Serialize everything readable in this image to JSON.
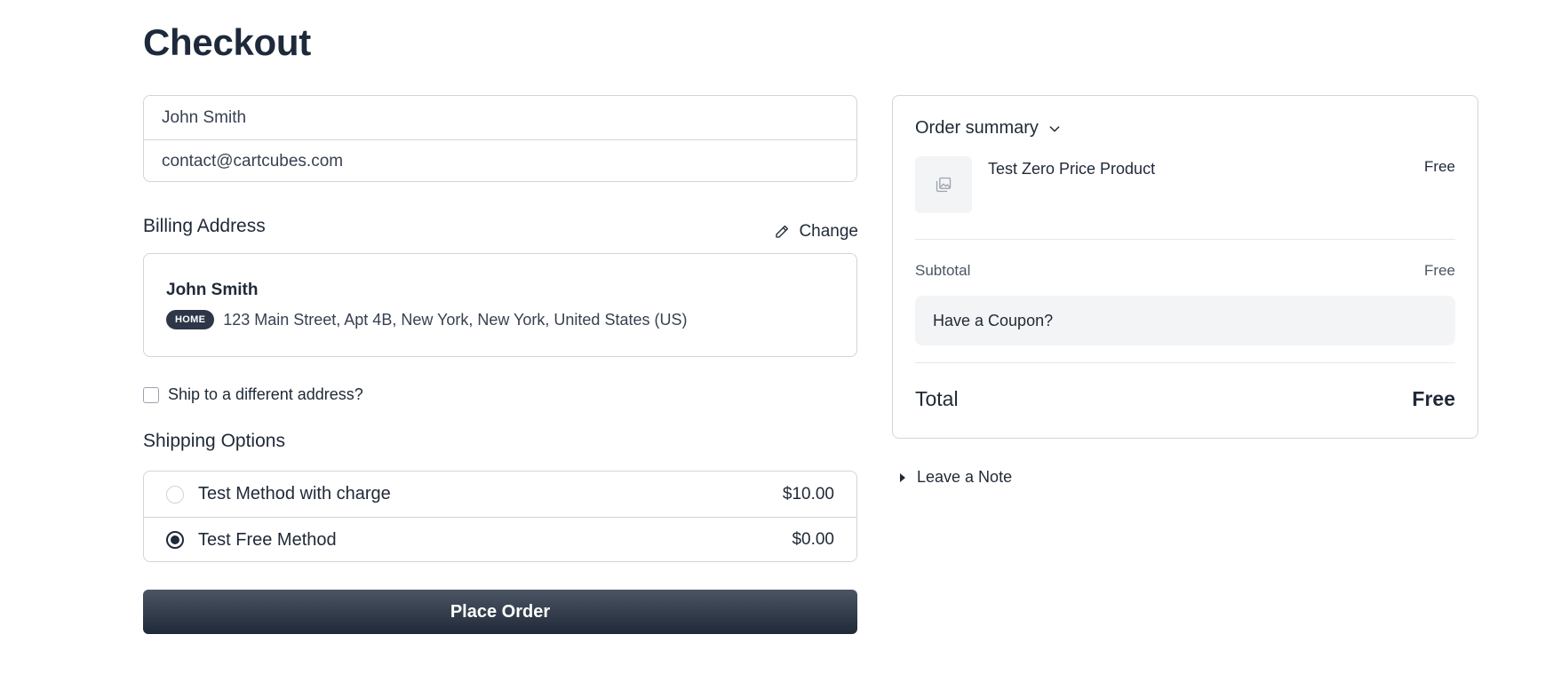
{
  "page": {
    "title": "Checkout"
  },
  "contact": {
    "name": "John Smith",
    "email": "contact@cartcubes.com"
  },
  "billing": {
    "heading": "Billing Address",
    "change_label": "Change",
    "name": "John Smith",
    "badge": "HOME",
    "address": "123 Main Street, Apt 4B, New York, New York, United States (US)"
  },
  "ship_different": {
    "label": "Ship to a different address?",
    "checked": false
  },
  "shipping": {
    "heading": "Shipping Options",
    "options": [
      {
        "name": "Test Method with charge",
        "price": "$10.00",
        "selected": false
      },
      {
        "name": "Test Free Method",
        "price": "$0.00",
        "selected": true
      }
    ]
  },
  "place_order": {
    "label": "Place Order"
  },
  "summary": {
    "toggle_label": "Order summary",
    "product": {
      "name": "Test Zero Price Product",
      "price": "Free"
    },
    "subtotal_label": "Subtotal",
    "subtotal_value": "Free",
    "coupon_label": "Have a Coupon?",
    "total_label": "Total",
    "total_value": "Free"
  },
  "note": {
    "label": "Leave a Note"
  },
  "icons": {
    "edit": "pencil-icon",
    "chevron": "chevron-down-icon",
    "image": "image-placeholder-icon",
    "caret": "caret-right-icon"
  }
}
